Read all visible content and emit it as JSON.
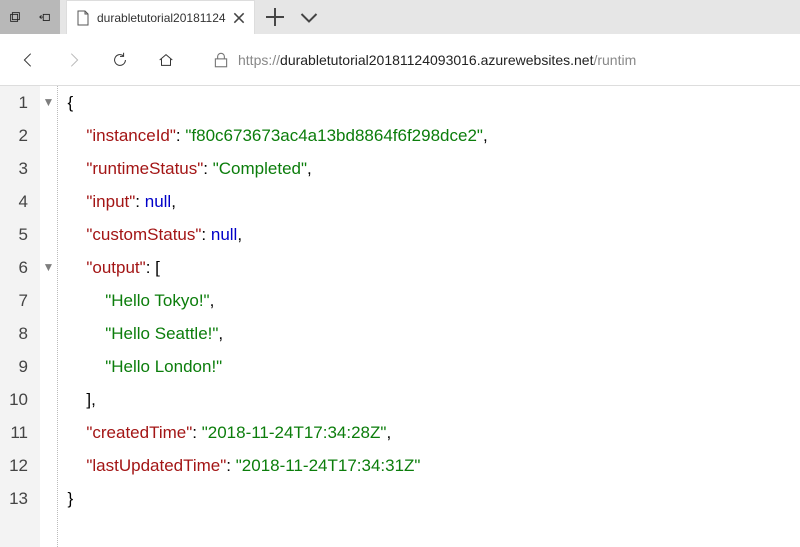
{
  "titlebar": {
    "tab_title": "durabletutorial20181124"
  },
  "navbar": {
    "url_scheme": "https://",
    "url_host": "durabletutorial20181124093016.azurewebsites.net",
    "url_rest": "/runtim"
  },
  "json": {
    "keys": {
      "instanceId": "\"instanceId\"",
      "runtimeStatus": "\"runtimeStatus\"",
      "input": "\"input\"",
      "customStatus": "\"customStatus\"",
      "output": "\"output\"",
      "createdTime": "\"createdTime\"",
      "lastUpdatedTime": "\"lastUpdatedTime\""
    },
    "values": {
      "instanceId": "\"f80c673673ac4a13bd8864f6f298dce2\"",
      "runtimeStatus": "\"Completed\"",
      "input": "null",
      "customStatus": "null",
      "output0": "\"Hello Tokyo!\"",
      "output1": "\"Hello Seattle!\"",
      "output2": "\"Hello London!\"",
      "createdTime": "\"2018-11-24T17:34:28Z\"",
      "lastUpdatedTime": "\"2018-11-24T17:34:31Z\""
    }
  },
  "lineNumbers": [
    "1",
    "2",
    "3",
    "4",
    "5",
    "6",
    "7",
    "8",
    "9",
    "10",
    "11",
    "12",
    "13"
  ]
}
